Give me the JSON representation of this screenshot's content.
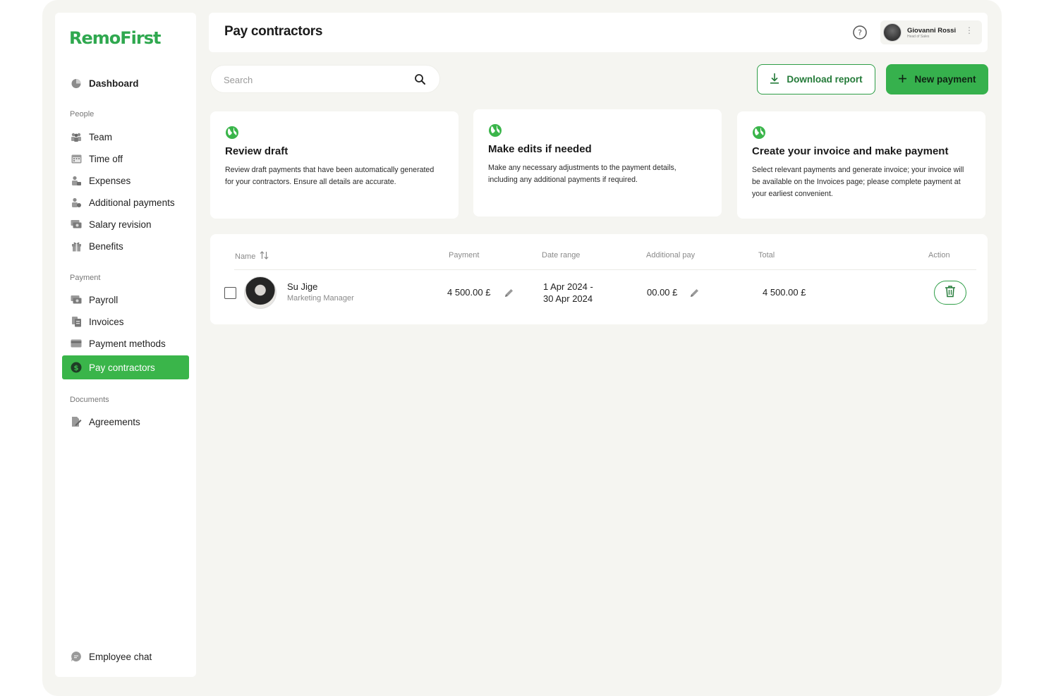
{
  "brand": {
    "logo": "RemoFirst",
    "accent": "#36b14d"
  },
  "sidebar": {
    "dashboard": "Dashboard",
    "sections": {
      "people": "People",
      "payment": "Payment",
      "documents": "Documents"
    },
    "people_items": [
      "Team",
      "Time off",
      "Expenses",
      "Additional payments",
      "Salary revision",
      "Benefits"
    ],
    "payment_items": [
      "Payroll",
      "Invoices",
      "Payment methods",
      "Pay contractors"
    ],
    "document_items": [
      "Agreements"
    ],
    "employee_chat": "Employee chat",
    "active": "Pay contractors"
  },
  "header": {
    "title": "Pay contractors",
    "user": {
      "name": "Giovanni Rossi",
      "role": "Head of Sales"
    }
  },
  "toolbar": {
    "search_placeholder": "Search",
    "download_label": "Download report",
    "new_payment_label": "New payment"
  },
  "cards": [
    {
      "title": "Review draft",
      "text": "Review draft payments that have been automatically generated for your contractors. Ensure all details are accurate."
    },
    {
      "title": "Make edits if needed",
      "text": "Make any necessary adjustments to the payment details, including any additional payments if required."
    },
    {
      "title": "Create your invoice and make payment",
      "text": "Select relevant payments and generate invoice; your invoice will be available on the Invoices page; please complete payment at your earliest convenient."
    }
  ],
  "table": {
    "columns": {
      "name": "Name",
      "payment": "Payment",
      "date_range": "Date range",
      "additional_pay": "Additional pay",
      "total": "Total",
      "action": "Action"
    },
    "rows": [
      {
        "name": "Su Jige",
        "role": "Marketing Manager",
        "payment": "4 500.00 £",
        "date_start": "1 Apr 2024 -",
        "date_end": "30 Apr 2024",
        "additional_pay": "00.00 £",
        "total": "4 500.00 £"
      }
    ]
  }
}
